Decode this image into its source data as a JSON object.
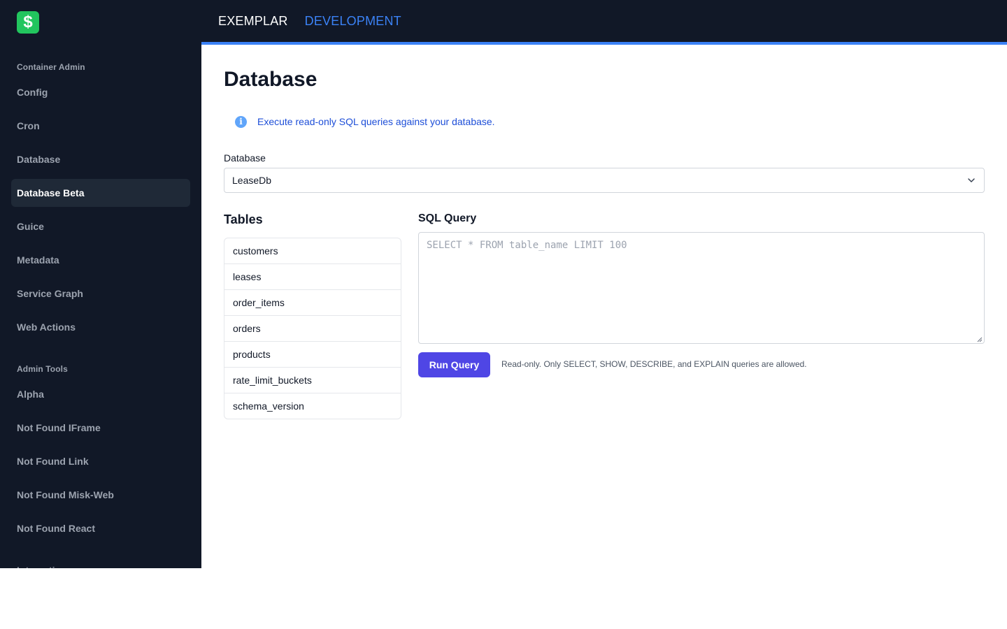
{
  "sidebar": {
    "logo_glyph": "$",
    "sections": [
      {
        "label": "Container Admin",
        "items": [
          {
            "label": "Config"
          },
          {
            "label": "Cron"
          },
          {
            "label": "Database"
          },
          {
            "label": "Database Beta",
            "active": true
          },
          {
            "label": "Guice"
          },
          {
            "label": "Metadata"
          },
          {
            "label": "Service Graph"
          },
          {
            "label": "Web Actions"
          }
        ]
      },
      {
        "label": "Admin Tools",
        "items": [
          {
            "label": "Alpha"
          },
          {
            "label": "Not Found IFrame"
          },
          {
            "label": "Not Found Link"
          },
          {
            "label": "Not Found Misk-Web"
          },
          {
            "label": "Not Found React"
          }
        ]
      }
    ],
    "truncated_section_label": "Interactive"
  },
  "topbar": {
    "app_name": "EXEMPLAR",
    "environment": "DEVELOPMENT"
  },
  "main": {
    "title": "Database",
    "info_text": "Execute read-only SQL queries against your database.",
    "database_label": "Database",
    "database_selected": "LeaseDb",
    "tables_title": "Tables",
    "tables": [
      "customers",
      "leases",
      "order_items",
      "orders",
      "products",
      "rate_limit_buckets",
      "schema_version"
    ],
    "sql_title": "SQL Query",
    "sql_placeholder": "SELECT * FROM table_name LIMIT 100",
    "sql_value": "",
    "run_button": "Run Query",
    "hint": "Read-only. Only SELECT, SHOW, DESCRIBE, and EXPLAIN queries are allowed."
  },
  "colors": {
    "sidebar_bg": "#111827",
    "active_item_bg": "#1f2937",
    "accent_blue": "#3b82f6",
    "logo_green": "#22c55e",
    "button_indigo": "#4f46e5"
  }
}
